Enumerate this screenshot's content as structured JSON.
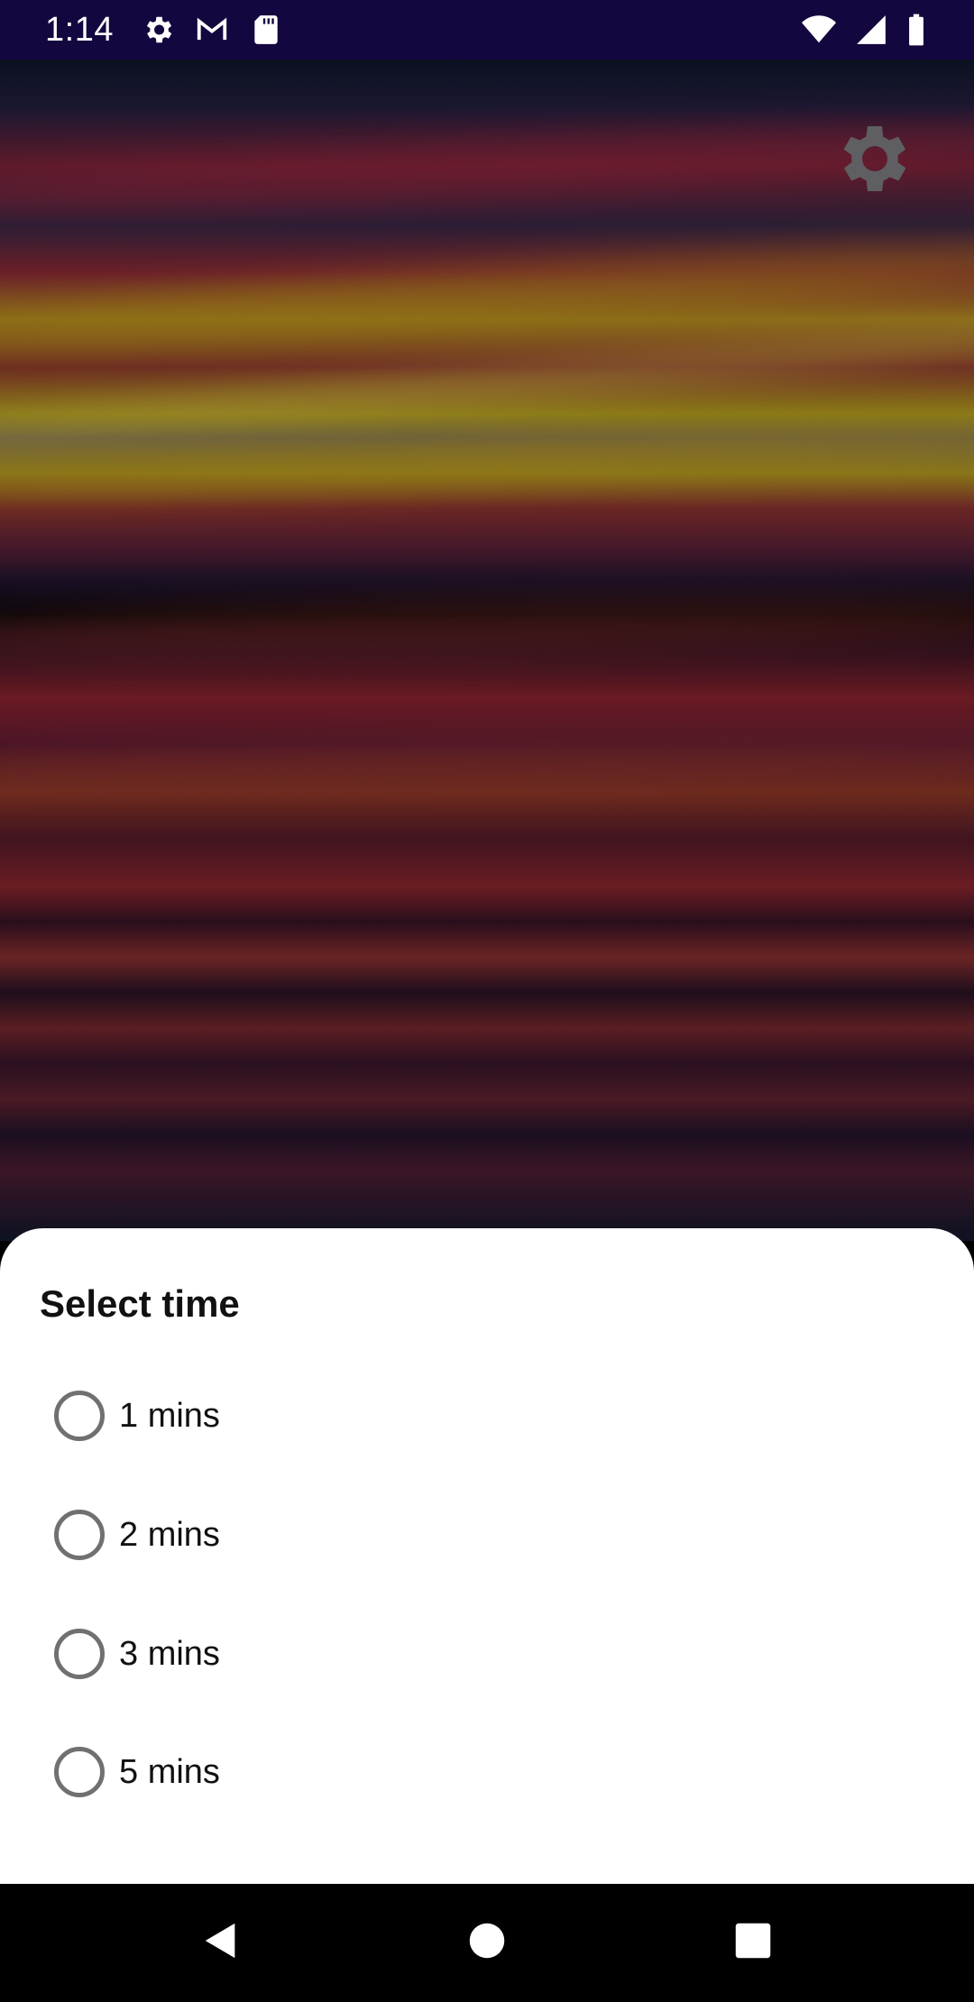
{
  "status_bar": {
    "time": "1:14",
    "left_icons": [
      "settings-icon",
      "gmail-icon",
      "sd-card-icon"
    ],
    "right_icons": [
      "wifi-icon",
      "cellular-signal-icon",
      "battery-icon"
    ]
  },
  "wallpaper": {
    "settings_icon": "gear-icon"
  },
  "sheet": {
    "title": "Select time",
    "options": [
      {
        "label": "1 mins",
        "selected": false
      },
      {
        "label": "2 mins",
        "selected": false
      },
      {
        "label": "3 mins",
        "selected": false
      },
      {
        "label": "5 mins",
        "selected": false
      }
    ]
  },
  "nav_bar": {
    "buttons": [
      "back-icon",
      "home-icon",
      "recents-icon"
    ]
  },
  "colors": {
    "status_bar_bg": "#14063f",
    "sheet_bg": "#ffffff",
    "radio_border": "#707070",
    "nav_bar_bg": "#000000"
  }
}
